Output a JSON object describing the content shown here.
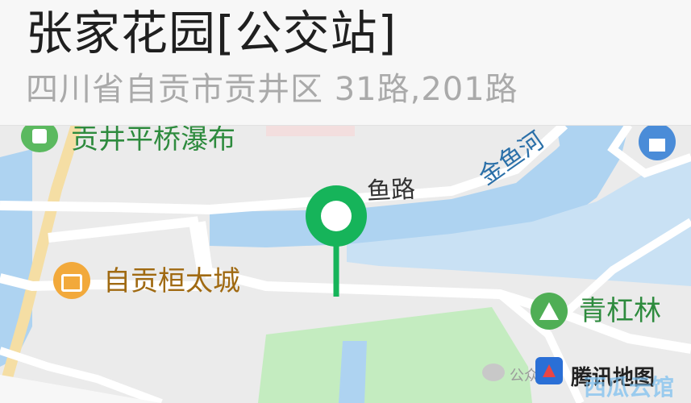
{
  "header": {
    "title": "张家花园[公交站]",
    "subtitle": "四川省自贡市贡井区 31路,201路"
  },
  "map": {
    "pois": [
      {
        "name": "贡井平桥瀑布",
        "icon": "park-icon",
        "color": "#2e8b3e"
      },
      {
        "name": "自贡桓太城",
        "icon": "shopping-bag-icon",
        "color": "#a06a12"
      },
      {
        "name": "青杠林",
        "icon": "tree-icon",
        "color": "#2e8b3e"
      }
    ],
    "roads": [
      {
        "name": "鱼路"
      }
    ],
    "rivers": [
      {
        "name": "金鱼河"
      }
    ],
    "home_icon": "home-icon",
    "marker": {
      "icon": "location-pin-icon",
      "color": "#16b45a"
    }
  },
  "footer": {
    "watermark": "公众号",
    "map_brand": "腾讯地图",
    "site_watermark": "西瓜云馆"
  },
  "colors": {
    "land": "#ebebeb",
    "water": "#aed3f1",
    "green": "#c4ecc0",
    "road": "#ffffff",
    "marker": "#16b45a"
  }
}
